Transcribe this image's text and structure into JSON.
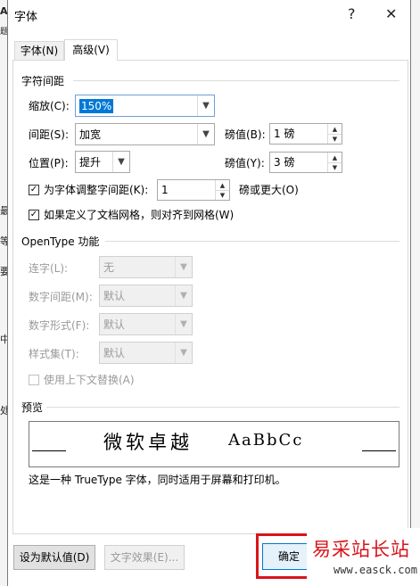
{
  "window": {
    "title": "字体",
    "help": "?",
    "close": "✕"
  },
  "background": {
    "chars": [
      "A",
      "题",
      "最",
      "等",
      "要",
      "中",
      "处"
    ]
  },
  "tabs": [
    {
      "label": "字体(N)"
    },
    {
      "label": "高级(V)"
    }
  ],
  "spacing": {
    "heading": "字符间距",
    "scale": {
      "label": "缩放(C):",
      "value": "150%"
    },
    "spacing": {
      "label": "间距(S):",
      "value": "加宽",
      "by_label": "磅值(B):",
      "by_value": "1 磅"
    },
    "position": {
      "label": "位置(P):",
      "value": "提升",
      "by_label": "磅值(Y):",
      "by_value": "3 磅"
    },
    "kerning": {
      "label": "为字体调整字间距(K):",
      "value": "1",
      "suffix": "磅或更大(O)",
      "checked": true
    },
    "grid": {
      "label": "如果定义了文档网格，则对齐到网格(W)",
      "checked": true
    }
  },
  "opentype": {
    "heading": "OpenType 功能",
    "ligatures": {
      "label": "连字(L):",
      "value": "无"
    },
    "number_spacing": {
      "label": "数字间距(M):",
      "value": "默认"
    },
    "number_forms": {
      "label": "数字形式(F):",
      "value": "默认"
    },
    "stylistic_sets": {
      "label": "样式集(T):",
      "value": "默认"
    },
    "contextual": {
      "label": "使用上下文替换(A)",
      "checked": false
    }
  },
  "preview": {
    "heading": "预览",
    "sample_cjk": "微软卓越",
    "sample_latin": "AaBbCc",
    "note": "这是一种 TrueType 字体，同时适用于屏幕和打印机。"
  },
  "footer": {
    "default_button": "设为默认值(D)",
    "effects_button": "文字效果(E)...",
    "ok_button": "确定"
  },
  "watermark": {
    "text": "易采站长站",
    "url": "www.easck.com"
  },
  "colors": {
    "accent": "#0078d7",
    "highlight_border": "#d9141b",
    "watermark_red": "#d9141b"
  }
}
